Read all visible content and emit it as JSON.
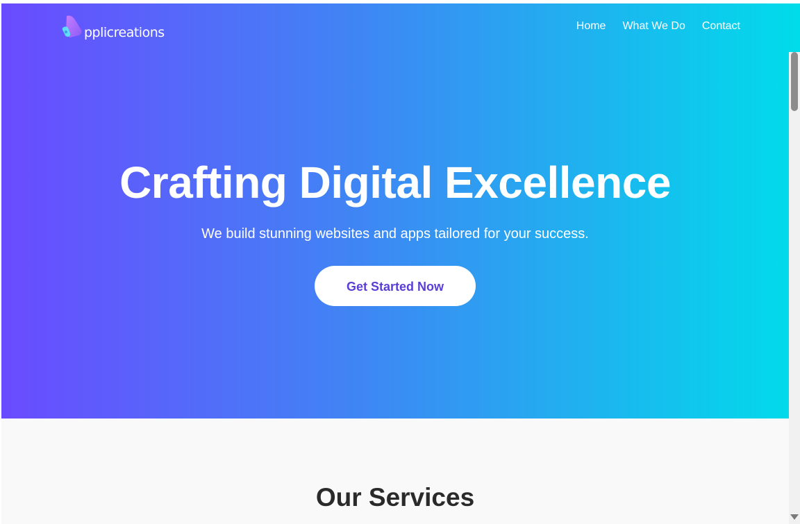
{
  "navbar": {
    "logo_text": "pplicreations",
    "logo_icon": "applicreations-logo-icon",
    "links": [
      {
        "label": "Home"
      },
      {
        "label": "What We Do"
      },
      {
        "label": "Contact"
      }
    ]
  },
  "hero": {
    "title": "Crafting Digital Excellence",
    "subtitle": "We build stunning websites and apps tailored for your success.",
    "cta_label": "Get Started Now"
  },
  "services": {
    "title": "Our Services"
  },
  "colors": {
    "gradient_start": "#6a4bff",
    "gradient_end": "#00dcea",
    "cta_text": "#5b3ed6",
    "section_bg": "#f9f9f9"
  }
}
